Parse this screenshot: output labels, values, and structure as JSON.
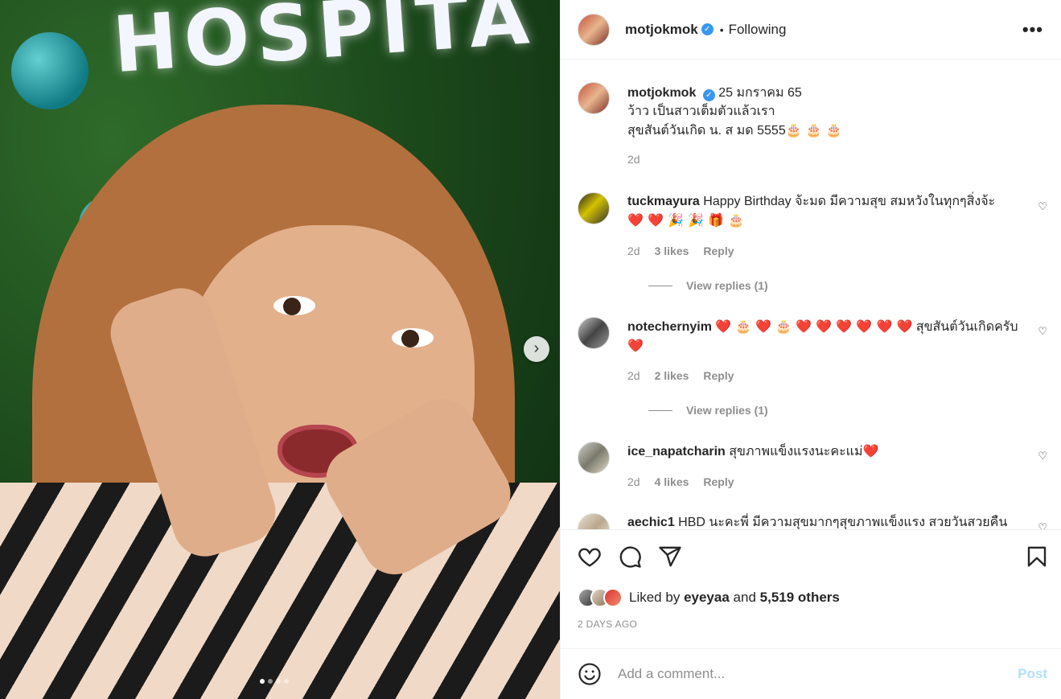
{
  "photo": {
    "sign_text": "HOSPITA",
    "next_icon": "chevron-right-icon",
    "carousel_count": 4,
    "carousel_active": 1
  },
  "header": {
    "username": "motjokmok",
    "separator": "•",
    "following_label": "Following",
    "more_icon": "more-horizontal-icon",
    "more_label": "•••"
  },
  "caption": {
    "username": "motjokmok",
    "date": "25 มกราคม 65",
    "line1": "ว้าว เป็นสาวเต็มตัวแล้วเรา",
    "line2": "สุขสันต์วันเกิด น. ส มด 5555",
    "line2_emoji": "🎂 🎂 🎂",
    "time": "2d"
  },
  "comments": [
    {
      "username": "tuckmayura",
      "text": "Happy Birthday จ้ะมด มีความสุข สมหวังในทุกๆสิ่งจ้ะ",
      "emoji": "❤️ ❤️ 🎉 🎉 🎁 🎂",
      "time": "2d",
      "likes": "3 likes",
      "reply": "Reply",
      "view_replies": "View replies (1)"
    },
    {
      "username": "notechernyim",
      "emoji_lead": "❤️ 🎂 ❤️ 🎂 ❤️ ❤️ ❤️ ❤️ ❤️ ❤️",
      "text": "สุขสันต์วันเกิดครับ",
      "emoji_tail": "❤️",
      "time": "2d",
      "likes": "2 likes",
      "reply": "Reply",
      "view_replies": "View replies (1)"
    },
    {
      "username": "ice_napatcharin",
      "text": "สุขภาพแข็งแรงนะคะแม่",
      "emoji": "❤️",
      "time": "2d",
      "likes": "4 likes",
      "reply": "Reply"
    },
    {
      "username": "aechic1",
      "text": "HBD นะคะพี่ มีความสุขมากๆสุขภาพแข็งแรง สวยวันสวยคืน"
    }
  ],
  "actions": {
    "like_icon": "heart-icon",
    "comment_icon": "comment-icon",
    "share_icon": "send-icon",
    "save_icon": "bookmark-icon",
    "liked_by_prefix": "Liked by",
    "liked_by_user": "eyeyaa",
    "liked_by_and": "and",
    "liked_by_others": "5,519 others",
    "time_ago": "2 DAYS AGO"
  },
  "add_comment": {
    "emoji_icon": "smiley-icon",
    "placeholder": "Add a comment...",
    "post_label": "Post"
  },
  "colors": {
    "accent": "#0095f6",
    "post_disabled": "#b2dffc",
    "muted": "#8e8e8e",
    "verified": "#3897f0"
  }
}
